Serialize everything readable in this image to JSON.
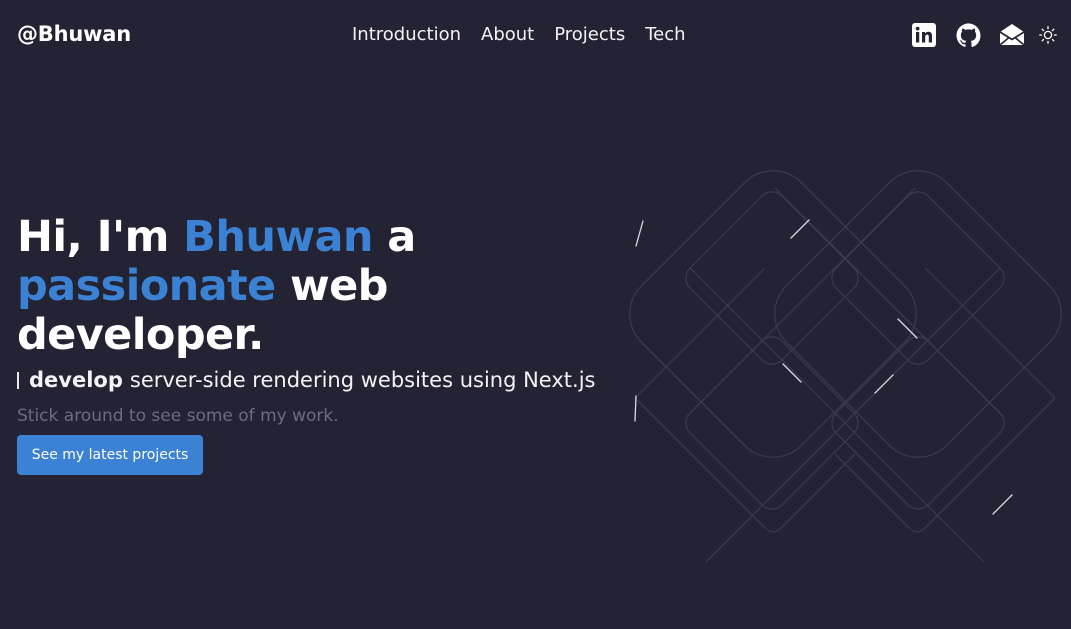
{
  "header": {
    "brand": "@Bhuwan",
    "nav": [
      "Introduction",
      "About",
      "Projects",
      "Tech"
    ],
    "icons": [
      "linkedin-icon",
      "github-icon",
      "mail-icon",
      "sun-icon"
    ]
  },
  "hero": {
    "title_part1": "Hi, I'm ",
    "title_name": "Bhuwan",
    "title_part2": " a",
    "title_accent2": "passionate",
    "title_part3": " web developer.",
    "typing_bold": "develop",
    "typing_rest": "server-side rendering websites using Next.js",
    "subtitle": "Stick around to see some of my work.",
    "cta": "See my latest projects"
  },
  "colors": {
    "background": "#232334",
    "accent": "#3b82d4",
    "muted": "#6c6c82"
  }
}
